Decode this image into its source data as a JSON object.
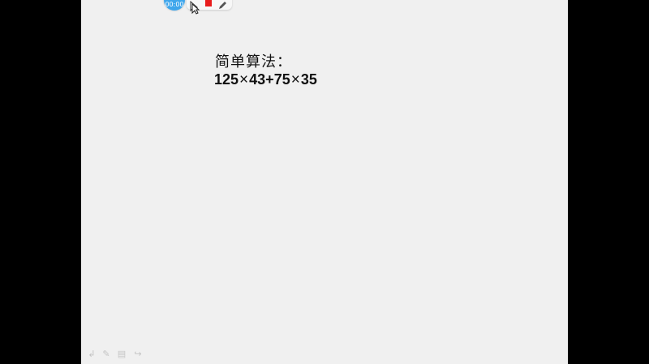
{
  "toolbar": {
    "timer": "00:00",
    "icons": [
      "pointer-icon",
      "stop-icon",
      "pen-icon"
    ],
    "stop_color": "#e81c1c",
    "timer_color": "#3ea6ec"
  },
  "content": {
    "heading": "简单算法：",
    "expression_parts": [
      "125",
      "×",
      "43+75",
      "×",
      "35"
    ]
  },
  "bottom_controls": {
    "icons": [
      "undo-icon",
      "pen-icon",
      "slides-icon",
      "redo-icon"
    ],
    "glyphs": [
      "↲",
      "✎",
      "▤",
      "↪"
    ]
  }
}
